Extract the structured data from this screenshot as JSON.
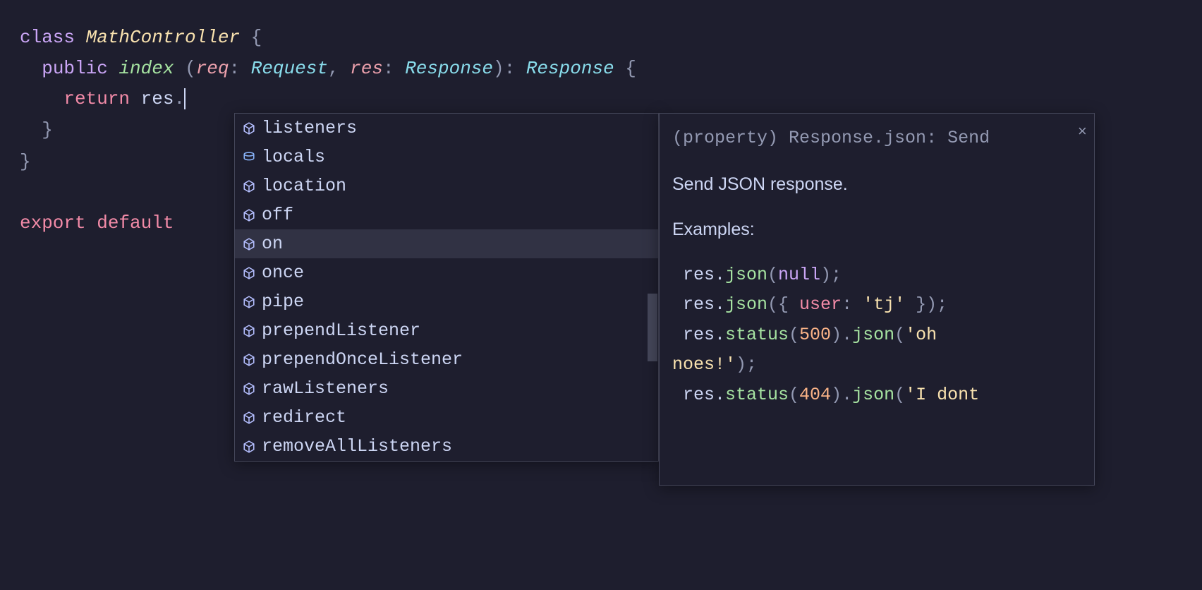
{
  "code": {
    "kw_class": "class",
    "class_name": "MathController",
    "open_brace": " {",
    "kw_public": "public",
    "method_name": "index",
    "open_paren": " (",
    "param_req": "req",
    "colon1": ": ",
    "type_request": "Request",
    "comma": ", ",
    "param_res": "res",
    "colon2": ": ",
    "type_response": "Response",
    "close_paren_colon": "): ",
    "return_type": "Response",
    "method_brace": " {",
    "kw_return": "return",
    "var_res": " res",
    "dot": ".",
    "close_method": "}",
    "close_class": "}",
    "kw_export": "export",
    "kw_default": " default ",
    "indent2": "  ",
    "indent4": "    ",
    "space": " "
  },
  "autocomplete": {
    "items": [
      {
        "label": "listeners",
        "icon": "method"
      },
      {
        "label": "locals",
        "icon": "field"
      },
      {
        "label": "location",
        "icon": "method"
      },
      {
        "label": "off",
        "icon": "method"
      },
      {
        "label": "on",
        "icon": "method",
        "selected": true
      },
      {
        "label": "once",
        "icon": "method"
      },
      {
        "label": "pipe",
        "icon": "method"
      },
      {
        "label": "prependListener",
        "icon": "method"
      },
      {
        "label": "prependOnceListener",
        "icon": "method"
      },
      {
        "label": "rawListeners",
        "icon": "method"
      },
      {
        "label": "redirect",
        "icon": "method"
      },
      {
        "label": "removeAllListeners",
        "icon": "method"
      }
    ]
  },
  "doc": {
    "signature_prefix": "(property) ",
    "signature_type": "Response.json",
    "signature_suffix": ": Send",
    "description": "Send JSON response.",
    "examples_heading": "Examples:",
    "ex1_res": " res.",
    "ex1_json": "json",
    "ex1_open": "(",
    "ex1_null": "null",
    "ex1_close": ");",
    "ex2_res": " res.",
    "ex2_json": "json",
    "ex2_open": "({ ",
    "ex2_key": "user",
    "ex2_colon": ": ",
    "ex2_str": "'tj'",
    "ex2_close": " });",
    "ex3_res": " res.",
    "ex3_status": "status",
    "ex3_p1": "(",
    "ex3_num": "500",
    "ex3_p2": ").",
    "ex3_json": "json",
    "ex3_p3": "(",
    "ex3_str_a": "'oh ",
    "ex3_str_b": "noes!'",
    "ex3_close": ");",
    "ex4_res": " res.",
    "ex4_status": "status",
    "ex4_p1": "(",
    "ex4_num": "404",
    "ex4_p2": ").",
    "ex4_json": "json",
    "ex4_p3": "(",
    "ex4_str": "'I dont",
    "close_icon": "×"
  }
}
